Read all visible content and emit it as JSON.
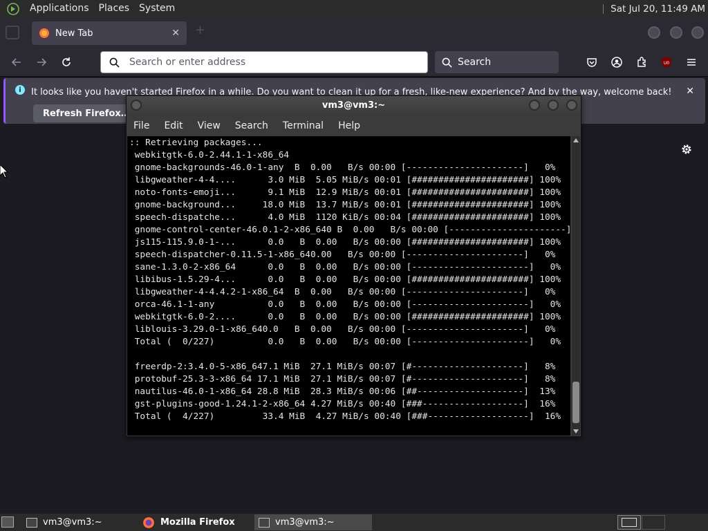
{
  "top_panel": {
    "menus": [
      "Applications",
      "Places",
      "System"
    ],
    "clock": "Sat Jul 20, 11:49 AM"
  },
  "firefox": {
    "tab_title": "New Tab",
    "tab_close": "✕",
    "url_placeholder": "Search or enter address",
    "search_placeholder": "Search",
    "notification": {
      "message": "It looks like you haven't started Firefox in a while. Do you want to clean it up for a fresh, like-new experience? And by the way, welcome back!",
      "button": "Refresh Firefox…",
      "close": "✕"
    },
    "ublock_badge": "U0"
  },
  "terminal": {
    "title": "vm3@vm3:~",
    "menu": [
      "File",
      "Edit",
      "View",
      "Search",
      "Terminal",
      "Help"
    ],
    "lines": [
      ":: Retrieving packages...",
      " webkitgtk-6.0-2.44.1-1-x86_64",
      " gnome-backgrounds-46.0-1-any  B  0.00   B/s 00:00 [----------------------]   0%",
      " libgweather-4-4....      3.0 MiB  5.05 MiB/s 00:01 [######################] 100%",
      " noto-fonts-emoji...      9.1 MiB  12.9 MiB/s 00:01 [######################] 100%",
      " gnome-background...     18.0 MiB  13.7 MiB/s 00:01 [######################] 100%",
      " speech-dispatche...      4.0 MiB  1120 KiB/s 00:04 [######################] 100%",
      " gnome-control-center-46.0.1-2-x86_640 B  0.00   B/s 00:00 [----------------------]   0%",
      " js115-115.9.0-1-...      0.0   B  0.00   B/s 00:00 [######################] 100%",
      " speech-dispatcher-0.11.5-1-x86_640.00   B/s 00:00 [----------------------]   0%",
      " sane-1.3.0-2-x86_64      0.0   B  0.00   B/s 00:00 [----------------------]   0%",
      " libibus-1.5.29-4...      0.0   B  0.00   B/s 00:00 [######################] 100%",
      " libgweather-4-4.4.2-1-x86_64  B  0.00   B/s 00:00 [----------------------]   0%",
      " orca-46.1-1-any          0.0   B  0.00   B/s 00:00 [----------------------]   0%",
      " webkitgtk-6.0-2....      0.0   B  0.00   B/s 00:00 [######################] 100%",
      " liblouis-3.29.0-1-x86_640.0   B  0.00   B/s 00:00 [----------------------]   0%",
      " Total (  0/227)          0.0   B  0.00   B/s 00:00 [----------------------]   0%",
      "",
      " freerdp-2:3.4.0-5-x86_647.1 MiB  27.1 MiB/s 00:07 [#---------------------]   8%",
      " protobuf-25.3-3-x86_64 17.1 MiB  27.1 MiB/s 00:07 [#---------------------]   8%",
      " nautilus-46.0-1-x86_64 28.8 MiB  28.3 MiB/s 00:06 [##--------------------]  13%",
      " gst-plugins-good-1.24.1-2-x86_64 4.27 MiB/s 00:40 [###-------------------]  16%",
      " Total (  4/227)         33.4 MiB  4.27 MiB/s 00:40 [###-------------------]  16%"
    ]
  },
  "taskbar": {
    "items": [
      {
        "label": "vm3@vm3:~",
        "active": false
      },
      {
        "label": "Mozilla Firefox",
        "active": false
      },
      {
        "label": "vm3@vm3:~",
        "active": true
      }
    ]
  }
}
